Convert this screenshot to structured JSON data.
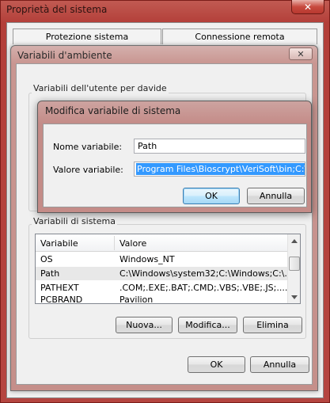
{
  "system_properties": {
    "title": "Proprietà del sistema",
    "close_glyph": "✕",
    "tabs": [
      {
        "label": "Protezione sistema"
      },
      {
        "label": "Connessione remota"
      }
    ]
  },
  "env_dialog": {
    "title": "Variabili d'ambiente",
    "close_glyph": "✕",
    "user_group_label": "Variabili dell'utente per davide",
    "system_group_label": "Variabili di sistema",
    "columns": [
      "Variabile",
      "Valore"
    ],
    "rows": [
      {
        "name": "OS",
        "value": "Windows_NT"
      },
      {
        "name": "Path",
        "value": "C:\\Windows\\system32;C:\\Windows;C:\\..."
      },
      {
        "name": "PATHEXT",
        "value": ".COM;.EXE;.BAT;.CMD;.VBS;.VBE;.JS;...."
      },
      {
        "name": "PCBRAND",
        "value": "Pavilion"
      }
    ],
    "buttons": {
      "new": "Nuova...",
      "edit": "Modifica...",
      "delete": "Elimina",
      "ok": "OK",
      "cancel": "Annulla"
    }
  },
  "edit_dialog": {
    "title": "Modifica variabile di sistema",
    "name_label": "Nome variabile:",
    "name_value": "Path",
    "value_label": "Valore variabile:",
    "value_value": "Program Files\\Bioscrypt\\VeriSoft\\bin;C:\\php",
    "ok": "OK",
    "cancel": "Annulla"
  },
  "icons": {
    "outer_close": "close-icon",
    "env_close": "close-icon",
    "scroll_up": "scroll-up-arrow-icon",
    "scroll_down": "scroll-down-arrow-icon"
  }
}
